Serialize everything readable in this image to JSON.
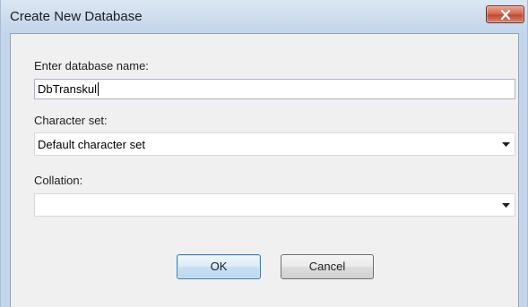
{
  "window": {
    "title": "Create New Database",
    "close_icon": "close-icon"
  },
  "form": {
    "name_label": "Enter database name:",
    "name_value": "DbTranskul",
    "charset_label": "Character set:",
    "charset_value": "Default character set",
    "collation_label": "Collation:",
    "collation_value": ""
  },
  "buttons": {
    "ok_label": "OK",
    "cancel_label": "Cancel"
  },
  "colors": {
    "title_bar": "#cddcee",
    "close_button": "#c94f38",
    "dialog_body": "#f0f0f0",
    "default_button_border": "#3c7fb1"
  }
}
